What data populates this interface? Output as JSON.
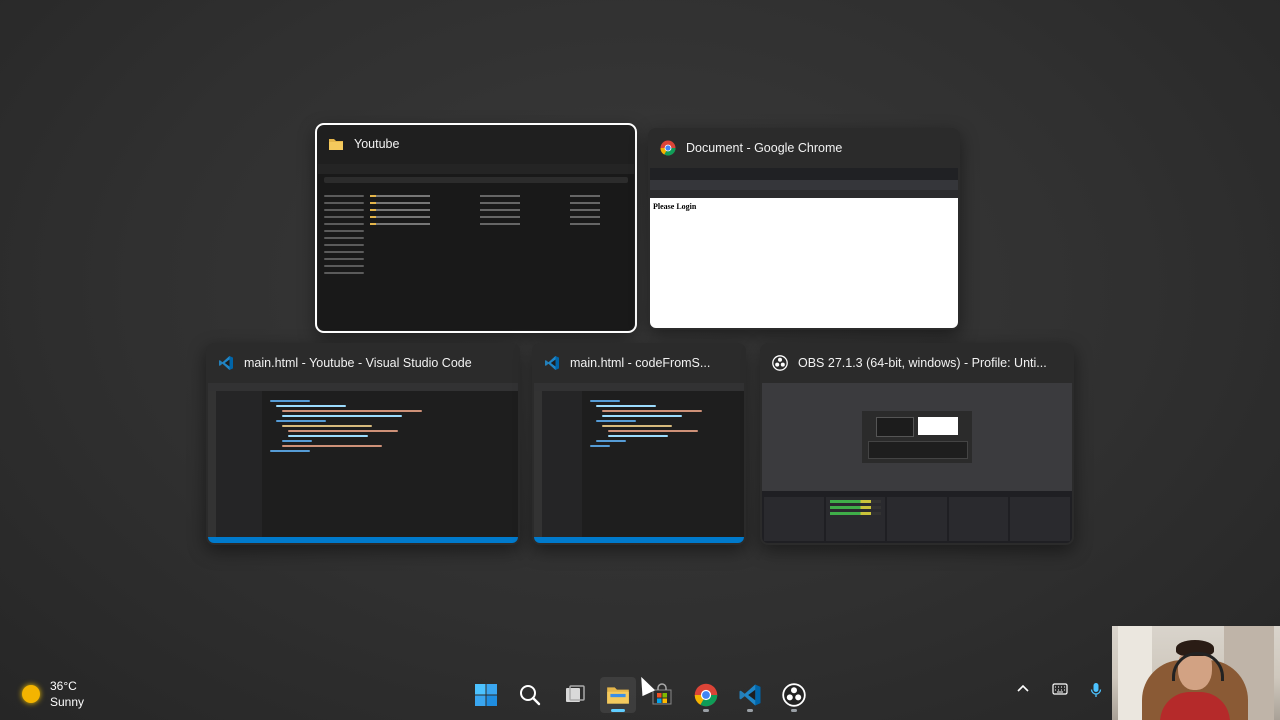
{
  "task_switcher": {
    "windows": [
      {
        "title": "Youtube",
        "icon": "folder-icon",
        "selected": true
      },
      {
        "title": "Document - Google Chrome",
        "icon": "chrome-icon",
        "preview_text": "Please Login"
      },
      {
        "title": "main.html - Youtube - Visual Studio Code",
        "icon": "vscode-icon"
      },
      {
        "title": "main.html - codeFromS...",
        "icon": "vscode-icon"
      },
      {
        "title": "OBS 27.1.3 (64-bit, windows) - Profile: Unti...",
        "icon": "obs-icon"
      }
    ]
  },
  "taskbar": {
    "weather": {
      "temperature": "36°C",
      "condition": "Sunny"
    },
    "apps": [
      {
        "name": "start",
        "icon": "windows-start-icon"
      },
      {
        "name": "search",
        "icon": "search-icon"
      },
      {
        "name": "task-view",
        "icon": "task-view-icon"
      },
      {
        "name": "file-explorer",
        "icon": "file-explorer-icon",
        "active": true
      },
      {
        "name": "microsoft-store",
        "icon": "store-icon"
      },
      {
        "name": "google-chrome",
        "icon": "chrome-icon"
      },
      {
        "name": "visual-studio-code",
        "icon": "vscode-icon"
      },
      {
        "name": "obs-studio",
        "icon": "obs-icon"
      }
    ],
    "tray": [
      "chevron-up-icon",
      "keyboard-icon",
      "microphone-icon"
    ]
  },
  "colors": {
    "accent": "#60cdff",
    "folder": "#e4b54a",
    "vscode_blue": "#007acc"
  }
}
